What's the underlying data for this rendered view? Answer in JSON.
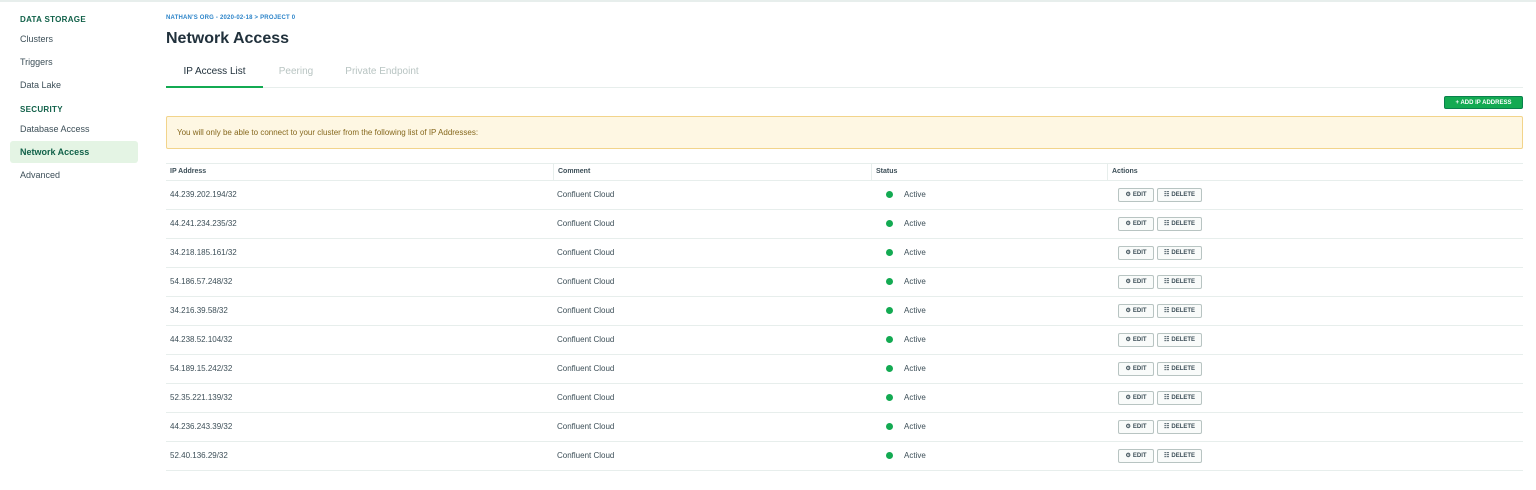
{
  "sidebar": {
    "data_storage_title": "DATA STORAGE",
    "data_storage_items": [
      "Clusters",
      "Triggers",
      "Data Lake"
    ],
    "security_title": "SECURITY",
    "security_items": [
      "Database Access",
      "Network Access",
      "Advanced"
    ],
    "active_item": "Network Access"
  },
  "breadcrumb": "NATHAN'S ORG - 2020-02-18 > PROJECT 0",
  "page_title": "Network Access",
  "tabs": [
    "IP Access List",
    "Peering",
    "Private Endpoint"
  ],
  "add_button_label": "+ ADD IP ADDRESS",
  "banner_text": "You will only be able to connect to your cluster from the following list of IP Addresses:",
  "table": {
    "headers": [
      "IP Address",
      "Comment",
      "Status",
      "Actions"
    ],
    "edit_label": "EDIT",
    "delete_label": "DELETE",
    "rows": [
      {
        "ip": "44.239.202.194/32",
        "comment": "Confluent Cloud",
        "status": "Active"
      },
      {
        "ip": "44.241.234.235/32",
        "comment": "Confluent Cloud",
        "status": "Active"
      },
      {
        "ip": "34.218.185.161/32",
        "comment": "Confluent Cloud",
        "status": "Active"
      },
      {
        "ip": "54.186.57.248/32",
        "comment": "Confluent Cloud",
        "status": "Active"
      },
      {
        "ip": "34.216.39.58/32",
        "comment": "Confluent Cloud",
        "status": "Active"
      },
      {
        "ip": "44.238.52.104/32",
        "comment": "Confluent Cloud",
        "status": "Active"
      },
      {
        "ip": "54.189.15.242/32",
        "comment": "Confluent Cloud",
        "status": "Active"
      },
      {
        "ip": "52.35.221.139/32",
        "comment": "Confluent Cloud",
        "status": "Active"
      },
      {
        "ip": "44.236.243.39/32",
        "comment": "Confluent Cloud",
        "status": "Active"
      },
      {
        "ip": "52.40.136.29/32",
        "comment": "Confluent Cloud",
        "status": "Active"
      }
    ]
  },
  "colors": {
    "accent_green": "#13aa52",
    "brand_dark_green": "#116149",
    "banner_bg": "#fef7e3",
    "breadcrumb_blue": "#2c84c9"
  },
  "icons": {
    "edit": "gear-icon",
    "delete": "trash-icon",
    "status": "status-dot-icon"
  }
}
